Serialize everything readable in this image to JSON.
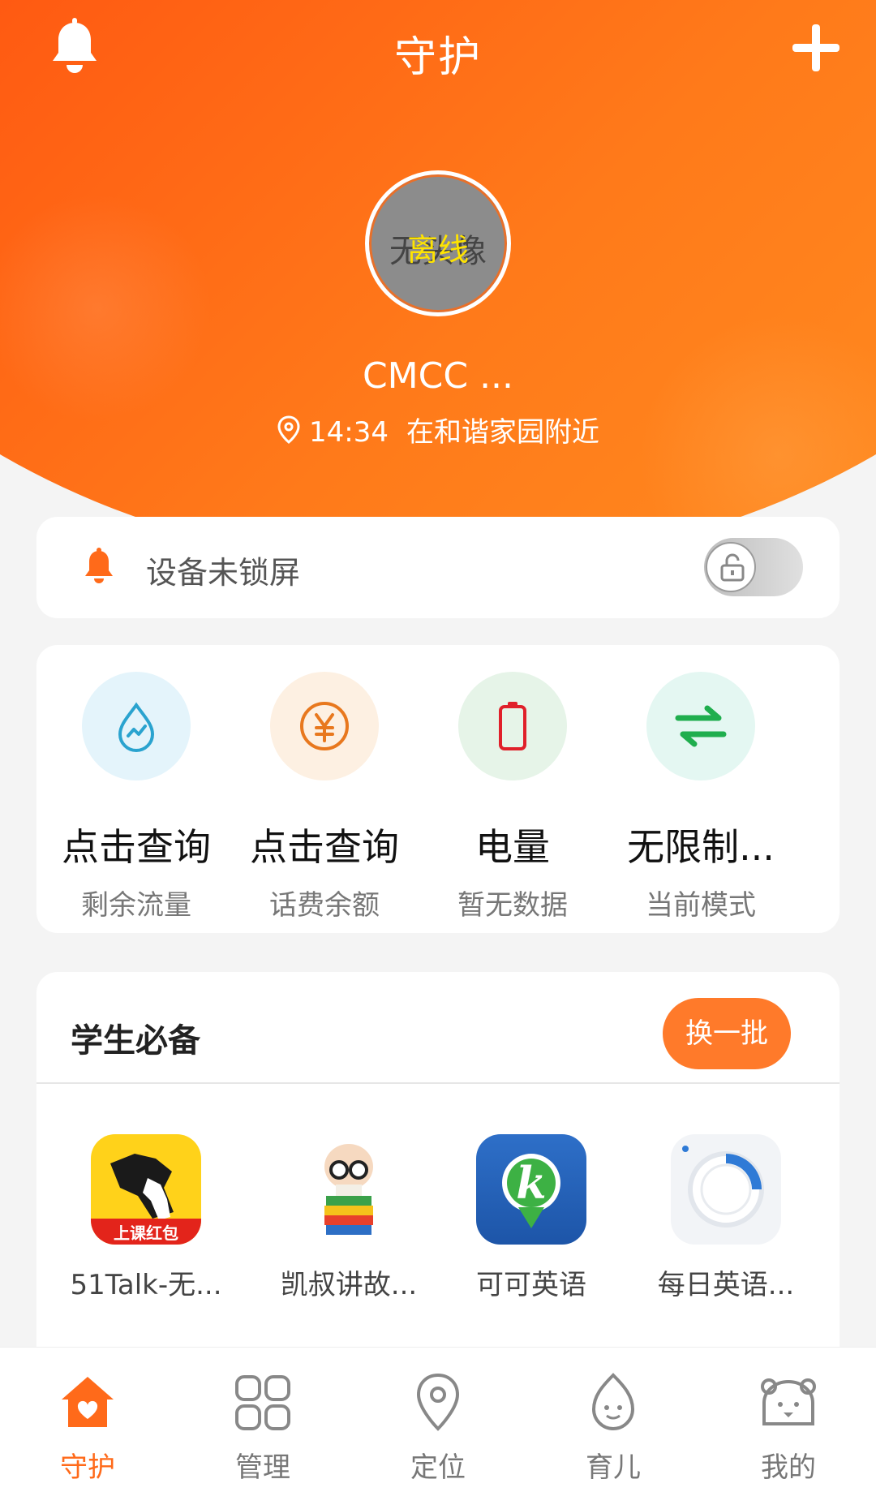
{
  "colors": {
    "brand": "#ff6a1a",
    "accent_button": "#ff7a2a",
    "status_offline": "#ffe400"
  },
  "header": {
    "title": "守护",
    "bell_icon": "bell-icon",
    "add_icon": "plus-icon"
  },
  "profile": {
    "avatar_placeholder": "无头像",
    "status": "离线",
    "device_name": "CMCC ...",
    "time": "14:34",
    "location": "在和谐家园附近"
  },
  "lock": {
    "text": "设备未锁屏",
    "toggle_on": false
  },
  "stats": [
    {
      "main": "点击查询",
      "sub": "剩余流量",
      "icon": "data-drop-icon"
    },
    {
      "main": "点击查询",
      "sub": "话费余额",
      "icon": "yuan-icon"
    },
    {
      "main": "电量",
      "sub": "暂无数据",
      "icon": "battery-icon"
    },
    {
      "main": "无限制...",
      "sub": "当前模式",
      "icon": "swap-arrows-icon"
    }
  ],
  "student": {
    "title": "学生必备",
    "refresh_label": "换一批",
    "apps": [
      {
        "name": "51Talk-无...",
        "badge": "上课红包"
      },
      {
        "name": "凯叔讲故..."
      },
      {
        "name": "可可英语",
        "glyph": "k"
      },
      {
        "name": "每日英语..."
      }
    ]
  },
  "nav": [
    {
      "label": "守护",
      "icon": "home-icon",
      "active": true
    },
    {
      "label": "管理",
      "icon": "grid-icon",
      "active": false
    },
    {
      "label": "定位",
      "icon": "location-pin-icon",
      "active": false
    },
    {
      "label": "育儿",
      "icon": "sprout-face-icon",
      "active": false
    },
    {
      "label": "我的",
      "icon": "bear-face-icon",
      "active": false
    }
  ]
}
